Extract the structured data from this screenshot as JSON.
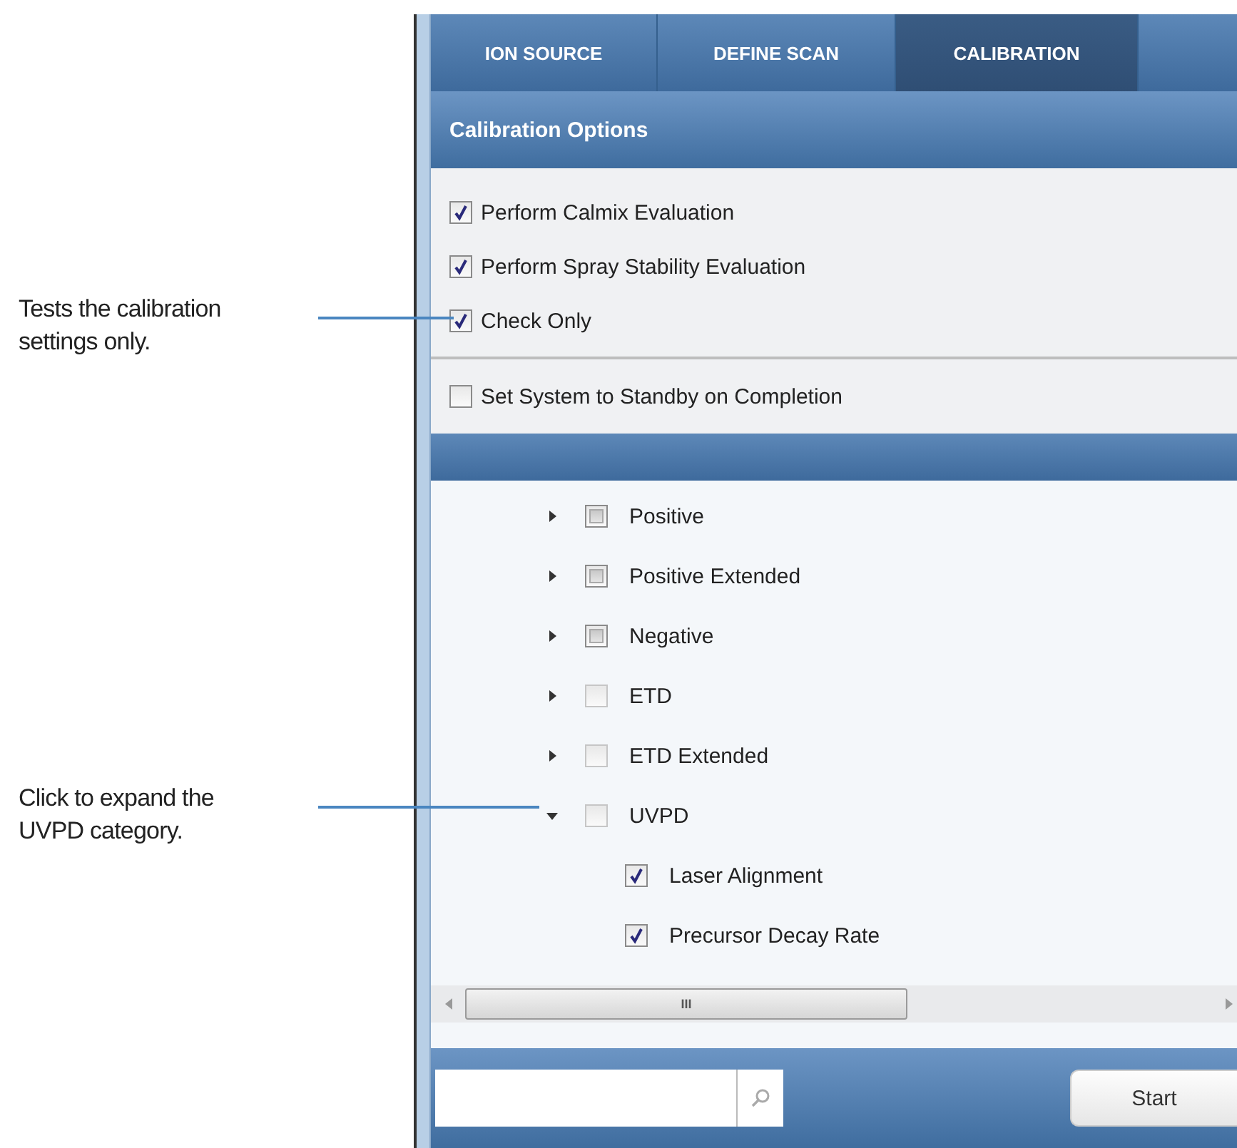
{
  "callouts": [
    {
      "text": "Tests the calibration settings only."
    },
    {
      "text": "Click to expand the UVPD category."
    }
  ],
  "tabs": [
    {
      "label": "ION SOURCE",
      "selected": false
    },
    {
      "label": "DEFINE SCAN",
      "selected": false
    },
    {
      "label": "CALIBRATION",
      "selected": true
    }
  ],
  "section_title": "Calibration Options",
  "options": [
    {
      "label": "Perform Calmix Evaluation",
      "checked": true
    },
    {
      "label": "Perform Spray Stability Evaluation",
      "checked": true
    },
    {
      "label": "Check Only",
      "checked": true
    }
  ],
  "standby_option": {
    "label": "Set System to Standby on Completion",
    "checked": false
  },
  "tree": [
    {
      "label": "Positive",
      "checked": false,
      "indeterminate": true,
      "expanded": false
    },
    {
      "label": "Positive Extended",
      "checked": false,
      "indeterminate": true,
      "expanded": false
    },
    {
      "label": "Negative",
      "checked": false,
      "indeterminate": true,
      "expanded": false
    },
    {
      "label": "ETD",
      "checked": false,
      "indeterminate": false,
      "expanded": false
    },
    {
      "label": "ETD Extended",
      "checked": false,
      "indeterminate": false,
      "expanded": false
    },
    {
      "label": "UVPD",
      "checked": false,
      "indeterminate": false,
      "expanded": true,
      "children": [
        {
          "label": "Laser Alignment",
          "checked": true
        },
        {
          "label": "Precursor Decay Rate",
          "checked": true
        }
      ]
    }
  ],
  "scrollbar_grip": "III",
  "start_button": "Start"
}
